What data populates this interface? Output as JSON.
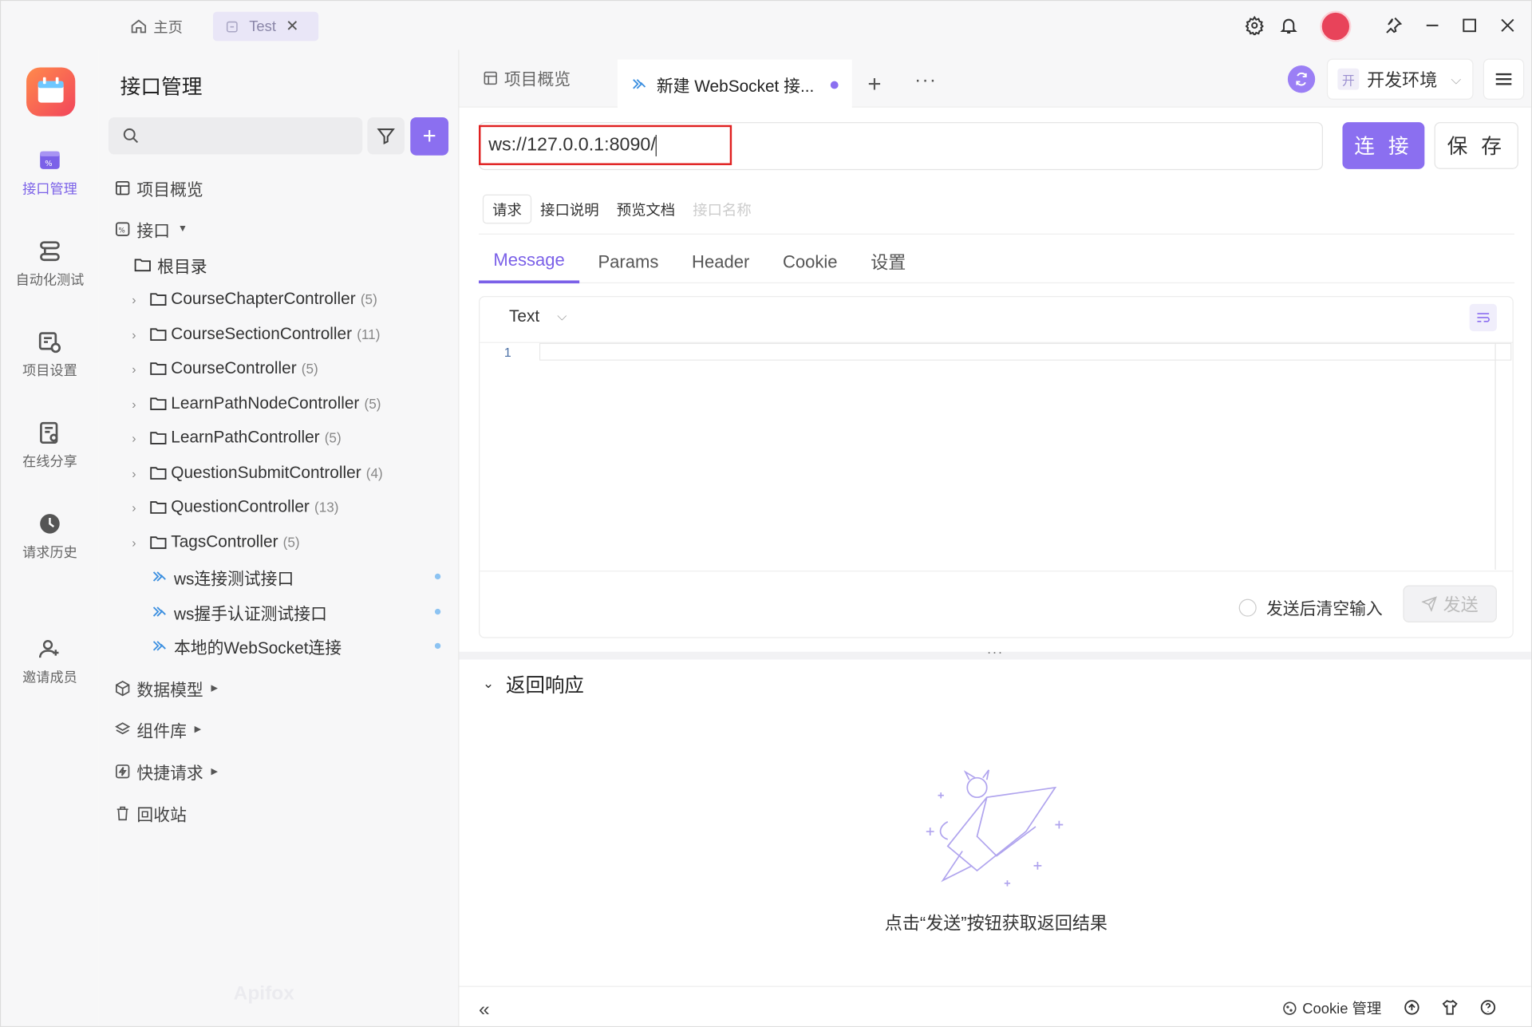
{
  "titlebar": {
    "home_tab": "主页",
    "test_tab": "Test"
  },
  "rail": {
    "items": [
      {
        "label": "接口管理",
        "icon": "api-icon",
        "active": true
      },
      {
        "label": "自动化测试",
        "icon": "automation-icon",
        "active": false
      },
      {
        "label": "项目设置",
        "icon": "project-settings-icon",
        "active": false
      },
      {
        "label": "在线分享",
        "icon": "share-icon",
        "active": false
      },
      {
        "label": "请求历史",
        "icon": "history-icon",
        "active": false
      },
      {
        "label": "邀请成员",
        "icon": "invite-member-icon",
        "active": false
      }
    ]
  },
  "sidebar": {
    "title": "接口管理",
    "search_placeholder": "",
    "overview": "项目概览",
    "api_section": "接口",
    "root": "根目录",
    "folders": [
      {
        "name": "CourseChapterController",
        "count": "(5)"
      },
      {
        "name": "CourseSectionController",
        "count": "(11)"
      },
      {
        "name": "CourseController",
        "count": "(5)"
      },
      {
        "name": "LearnPathNodeController",
        "count": "(5)"
      },
      {
        "name": "LearnPathController",
        "count": "(5)"
      },
      {
        "name": "QuestionSubmitController",
        "count": "(4)"
      },
      {
        "name": "QuestionController",
        "count": "(13)"
      },
      {
        "name": "TagsController",
        "count": "(5)"
      }
    ],
    "ws_items": [
      "ws连接测试接口",
      "ws握手认证测试接口",
      "本地的WebSocket连接"
    ],
    "sections": [
      "数据模型",
      "组件库",
      "快捷请求",
      "回收站"
    ],
    "watermark": "Apifox"
  },
  "main": {
    "tabs": [
      "项目概览",
      "新建 WebSocket 接..."
    ],
    "env_badge": "开",
    "env_label": "开发环境",
    "url": "ws://127.0.0.1:8090/",
    "connect_label": "连 接",
    "save_label": "保 存",
    "subtabs": [
      "请求",
      "接口说明",
      "预览文档"
    ],
    "name_placeholder": "接口名称",
    "req_tabs": [
      "Message",
      "Params",
      "Header",
      "Cookie",
      "设置"
    ],
    "editor_mode": "Text",
    "line_number": "1",
    "clear_after_send": "发送后清空输入",
    "send_label": "发送",
    "response_title": "返回响应",
    "empty_hint": "点击“发送”按钮获取返回结果",
    "cookie_manage": "Cookie 管理"
  },
  "colors": {
    "accent": "#8b6ff0",
    "highlight_border": "#e02020",
    "ws_icon": "#3b8fe0"
  }
}
